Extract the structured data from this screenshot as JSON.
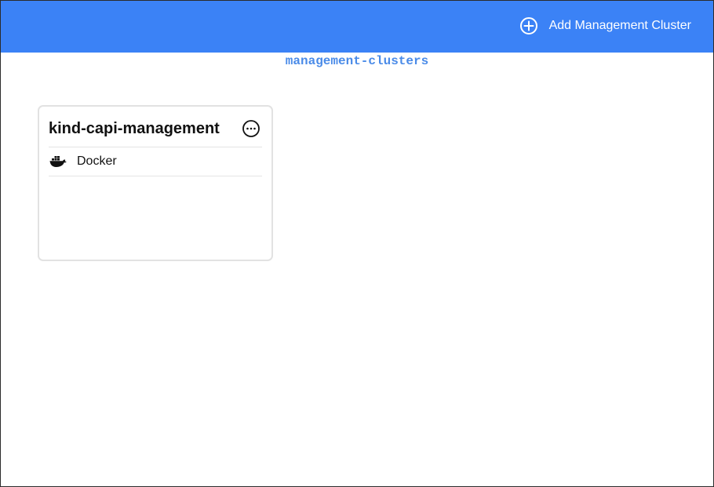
{
  "header": {
    "add_button_label": "Add Management Cluster",
    "background": "#3b82f6",
    "add_icon": "plus-circle-icon"
  },
  "page": {
    "title": "management-clusters",
    "title_color": "#4a8be8"
  },
  "clusters": [
    {
      "name": "kind-capi-management",
      "provider": "Docker",
      "provider_icon": "docker-icon",
      "menu_icon": "more-horizontal-icon"
    }
  ]
}
